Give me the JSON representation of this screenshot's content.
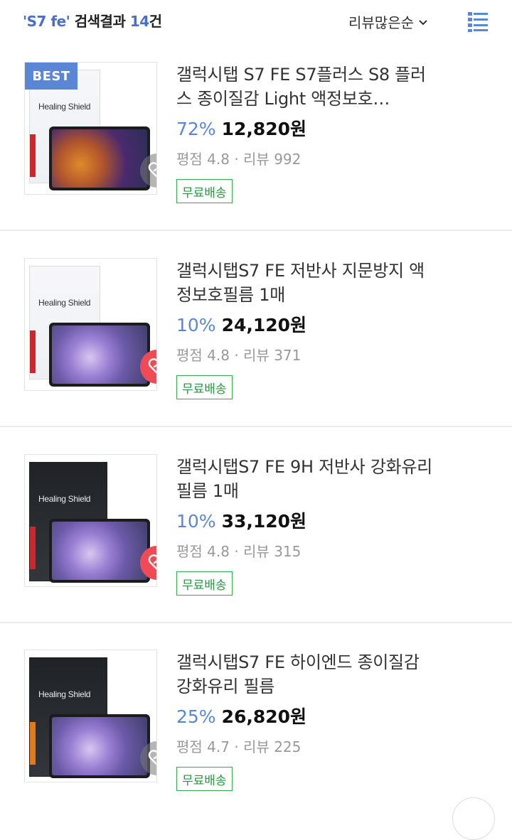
{
  "header": {
    "query": "'S7 fe'",
    "result_label": " 검색결과 ",
    "count": "14",
    "count_suffix": "건",
    "sort_label": "리뷰많은순",
    "sort_icon": "chevron-down-icon",
    "view_icon": "list-view-icon"
  },
  "colors": {
    "accent": "#5b86d6",
    "ship_green": "#2fae4e",
    "heart_red": "#f04b55"
  },
  "products": [
    {
      "badge": "BEST",
      "brand": "Healing Shield",
      "title": "갤럭시탭 S7 FE S7플러스 S8 플러스 종이질감 Light 액정보호…",
      "discount": "72%",
      "price": "12,820원",
      "meta": "평점 4.8 · 리뷰 992",
      "shipping": "무료배송",
      "wishlisted": false
    },
    {
      "badge": "",
      "brand": "Healing Shield",
      "title": "갤럭시탭S7 FE 저반사 지문방지 액정보호필름 1매",
      "discount": "10%",
      "price": "24,120원",
      "meta": "평점 4.8 · 리뷰 371",
      "shipping": "무료배송",
      "wishlisted": true
    },
    {
      "badge": "",
      "brand": "Healing Shield",
      "title": "갤럭시탭S7 FE 9H 저반사 강화유리필름 1매",
      "discount": "10%",
      "price": "33,120원",
      "meta": "평점 4.8 · 리뷰 315",
      "shipping": "무료배송",
      "wishlisted": true
    },
    {
      "badge": "",
      "brand": "Healing Shield",
      "title": "갤럭시탭S7 FE 하이엔드 종이질감 강화유리 필름",
      "discount": "25%",
      "price": "26,820원",
      "meta": "평점 4.7 · 리뷰 225",
      "shipping": "무료배송",
      "wishlisted": false
    }
  ]
}
